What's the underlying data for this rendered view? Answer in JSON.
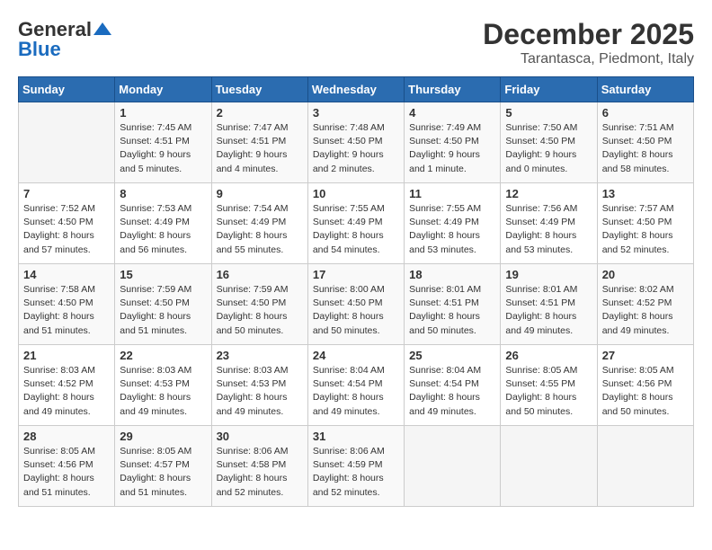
{
  "header": {
    "logo_line1": "General",
    "logo_line2": "Blue",
    "month": "December 2025",
    "location": "Tarantasca, Piedmont, Italy"
  },
  "weekdays": [
    "Sunday",
    "Monday",
    "Tuesday",
    "Wednesday",
    "Thursday",
    "Friday",
    "Saturday"
  ],
  "weeks": [
    [
      {
        "day": "",
        "sunrise": "",
        "sunset": "",
        "daylight": ""
      },
      {
        "day": "1",
        "sunrise": "Sunrise: 7:45 AM",
        "sunset": "Sunset: 4:51 PM",
        "daylight": "Daylight: 9 hours and 5 minutes."
      },
      {
        "day": "2",
        "sunrise": "Sunrise: 7:47 AM",
        "sunset": "Sunset: 4:51 PM",
        "daylight": "Daylight: 9 hours and 4 minutes."
      },
      {
        "day": "3",
        "sunrise": "Sunrise: 7:48 AM",
        "sunset": "Sunset: 4:50 PM",
        "daylight": "Daylight: 9 hours and 2 minutes."
      },
      {
        "day": "4",
        "sunrise": "Sunrise: 7:49 AM",
        "sunset": "Sunset: 4:50 PM",
        "daylight": "Daylight: 9 hours and 1 minute."
      },
      {
        "day": "5",
        "sunrise": "Sunrise: 7:50 AM",
        "sunset": "Sunset: 4:50 PM",
        "daylight": "Daylight: 9 hours and 0 minutes."
      },
      {
        "day": "6",
        "sunrise": "Sunrise: 7:51 AM",
        "sunset": "Sunset: 4:50 PM",
        "daylight": "Daylight: 8 hours and 58 minutes."
      }
    ],
    [
      {
        "day": "7",
        "sunrise": "Sunrise: 7:52 AM",
        "sunset": "Sunset: 4:50 PM",
        "daylight": "Daylight: 8 hours and 57 minutes."
      },
      {
        "day": "8",
        "sunrise": "Sunrise: 7:53 AM",
        "sunset": "Sunset: 4:49 PM",
        "daylight": "Daylight: 8 hours and 56 minutes."
      },
      {
        "day": "9",
        "sunrise": "Sunrise: 7:54 AM",
        "sunset": "Sunset: 4:49 PM",
        "daylight": "Daylight: 8 hours and 55 minutes."
      },
      {
        "day": "10",
        "sunrise": "Sunrise: 7:55 AM",
        "sunset": "Sunset: 4:49 PM",
        "daylight": "Daylight: 8 hours and 54 minutes."
      },
      {
        "day": "11",
        "sunrise": "Sunrise: 7:55 AM",
        "sunset": "Sunset: 4:49 PM",
        "daylight": "Daylight: 8 hours and 53 minutes."
      },
      {
        "day": "12",
        "sunrise": "Sunrise: 7:56 AM",
        "sunset": "Sunset: 4:49 PM",
        "daylight": "Daylight: 8 hours and 53 minutes."
      },
      {
        "day": "13",
        "sunrise": "Sunrise: 7:57 AM",
        "sunset": "Sunset: 4:50 PM",
        "daylight": "Daylight: 8 hours and 52 minutes."
      }
    ],
    [
      {
        "day": "14",
        "sunrise": "Sunrise: 7:58 AM",
        "sunset": "Sunset: 4:50 PM",
        "daylight": "Daylight: 8 hours and 51 minutes."
      },
      {
        "day": "15",
        "sunrise": "Sunrise: 7:59 AM",
        "sunset": "Sunset: 4:50 PM",
        "daylight": "Daylight: 8 hours and 51 minutes."
      },
      {
        "day": "16",
        "sunrise": "Sunrise: 7:59 AM",
        "sunset": "Sunset: 4:50 PM",
        "daylight": "Daylight: 8 hours and 50 minutes."
      },
      {
        "day": "17",
        "sunrise": "Sunrise: 8:00 AM",
        "sunset": "Sunset: 4:50 PM",
        "daylight": "Daylight: 8 hours and 50 minutes."
      },
      {
        "day": "18",
        "sunrise": "Sunrise: 8:01 AM",
        "sunset": "Sunset: 4:51 PM",
        "daylight": "Daylight: 8 hours and 50 minutes."
      },
      {
        "day": "19",
        "sunrise": "Sunrise: 8:01 AM",
        "sunset": "Sunset: 4:51 PM",
        "daylight": "Daylight: 8 hours and 49 minutes."
      },
      {
        "day": "20",
        "sunrise": "Sunrise: 8:02 AM",
        "sunset": "Sunset: 4:52 PM",
        "daylight": "Daylight: 8 hours and 49 minutes."
      }
    ],
    [
      {
        "day": "21",
        "sunrise": "Sunrise: 8:03 AM",
        "sunset": "Sunset: 4:52 PM",
        "daylight": "Daylight: 8 hours and 49 minutes."
      },
      {
        "day": "22",
        "sunrise": "Sunrise: 8:03 AM",
        "sunset": "Sunset: 4:53 PM",
        "daylight": "Daylight: 8 hours and 49 minutes."
      },
      {
        "day": "23",
        "sunrise": "Sunrise: 8:03 AM",
        "sunset": "Sunset: 4:53 PM",
        "daylight": "Daylight: 8 hours and 49 minutes."
      },
      {
        "day": "24",
        "sunrise": "Sunrise: 8:04 AM",
        "sunset": "Sunset: 4:54 PM",
        "daylight": "Daylight: 8 hours and 49 minutes."
      },
      {
        "day": "25",
        "sunrise": "Sunrise: 8:04 AM",
        "sunset": "Sunset: 4:54 PM",
        "daylight": "Daylight: 8 hours and 49 minutes."
      },
      {
        "day": "26",
        "sunrise": "Sunrise: 8:05 AM",
        "sunset": "Sunset: 4:55 PM",
        "daylight": "Daylight: 8 hours and 50 minutes."
      },
      {
        "day": "27",
        "sunrise": "Sunrise: 8:05 AM",
        "sunset": "Sunset: 4:56 PM",
        "daylight": "Daylight: 8 hours and 50 minutes."
      }
    ],
    [
      {
        "day": "28",
        "sunrise": "Sunrise: 8:05 AM",
        "sunset": "Sunset: 4:56 PM",
        "daylight": "Daylight: 8 hours and 51 minutes."
      },
      {
        "day": "29",
        "sunrise": "Sunrise: 8:05 AM",
        "sunset": "Sunset: 4:57 PM",
        "daylight": "Daylight: 8 hours and 51 minutes."
      },
      {
        "day": "30",
        "sunrise": "Sunrise: 8:06 AM",
        "sunset": "Sunset: 4:58 PM",
        "daylight": "Daylight: 8 hours and 52 minutes."
      },
      {
        "day": "31",
        "sunrise": "Sunrise: 8:06 AM",
        "sunset": "Sunset: 4:59 PM",
        "daylight": "Daylight: 8 hours and 52 minutes."
      },
      {
        "day": "",
        "sunrise": "",
        "sunset": "",
        "daylight": ""
      },
      {
        "day": "",
        "sunrise": "",
        "sunset": "",
        "daylight": ""
      },
      {
        "day": "",
        "sunrise": "",
        "sunset": "",
        "daylight": ""
      }
    ]
  ]
}
